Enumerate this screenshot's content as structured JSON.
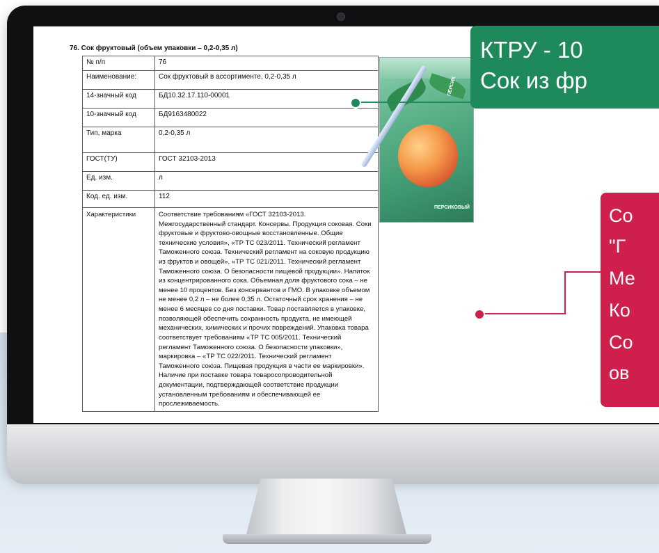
{
  "document": {
    "title": "76. Сок фруктовый (объем упаковки – 0,2-0,35 л)",
    "rows": [
      {
        "key": "№ п/п",
        "value": "76"
      },
      {
        "key": "Наименование:",
        "value": "Сок фруктовый в ассортименте, 0,2-0,35 л"
      },
      {
        "key": "14-значный код",
        "value": "БД10.32.17.110-00001"
      },
      {
        "key": "10-значный код",
        "value": "БД9163480022"
      },
      {
        "key": "Тип, марка",
        "value": "0,2-0,35 л"
      },
      {
        "key": "ГОСТ(ТУ)",
        "value": "ГОСТ 32103-2013"
      },
      {
        "key": "Ед. изм.",
        "value": "л"
      },
      {
        "key": "Код. ед. изм.",
        "value": "112"
      },
      {
        "key": "Характеристики",
        "value": "Соответствие требованиям «ГОСТ 32103-2013. Межгосударственный стандарт. Консервы. Продукция соковая. Соки фруктовые и фруктово-овощные восстановленные. Общие технические условия», «ТР ТС 023/2011. Технический регламент Таможенного союза. Технический регламент на соковую продукцию из фруктов и овощей», «ТР ТС 021/2011. Технический регламент Таможенного союза. О безопасности пищевой продукции». Напиток из концентрированного сока. Объемная доля фруктового сока – не менее 10 процентов. Без консервантов и ГМО. В упаковке объемом не менее 0,2 л – не более 0,35 л. Остаточный срок хранения – не менее 6 месяцев со дня поставки. Товар поставляется в упаковке, позволяющей обеспечить сохранность продукта, не имеющей механических, химических и прочих повреждений. Упаковка товара соответствует требованиям «ТР ТС 005/2011. Технический регламент Таможенного союза. О безопасности упаковки», маркировка – «ТР ТС 022/2011. Технический регламент Таможенного союза. Пищевая продукция в части ее маркировки». Наличие при поставке товара товаросопроводительной документации, подтверждающей соответствие продукции установленным требованиям и обеспечивающей ее прослеживаемость."
      }
    ]
  },
  "product_image": {
    "brand_label_top": "ПЕРСИК",
    "brand_label_bottom": "ПЕРСИКОВЫЙ"
  },
  "callouts": {
    "green": {
      "line1": "КТРУ - 10",
      "line2": "Сок из фр",
      "color": "#1e8a5c"
    },
    "red": {
      "lines": [
        "Со",
        "\"Г",
        "Ме",
        "Ко",
        "Со",
        "ов"
      ],
      "color": "#cf1f4c"
    }
  },
  "colors": {
    "background_band": "#d6e2ee",
    "monitor_bezel": "#0f1012"
  }
}
